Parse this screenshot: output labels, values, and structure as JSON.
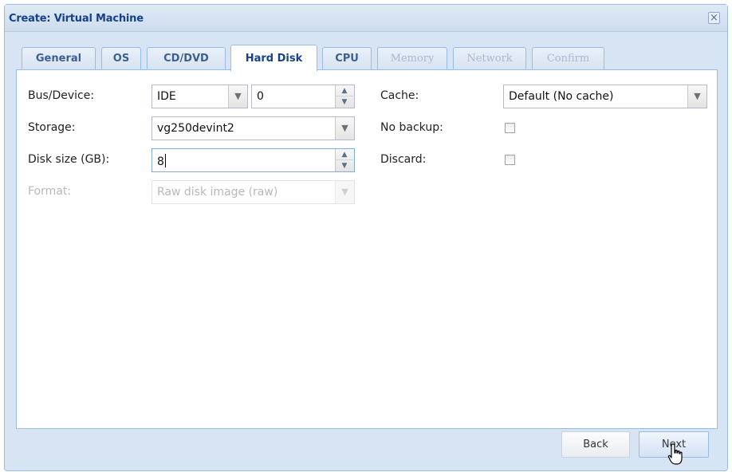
{
  "window": {
    "title": "Create: Virtual Machine",
    "close_symbol": "×"
  },
  "tabs": [
    {
      "label": "General",
      "state": "enabled"
    },
    {
      "label": "OS",
      "state": "enabled"
    },
    {
      "label": "CD/DVD",
      "state": "enabled"
    },
    {
      "label": "Hard Disk",
      "state": "active"
    },
    {
      "label": "CPU",
      "state": "enabled"
    },
    {
      "label": "Memory",
      "state": "disabled"
    },
    {
      "label": "Network",
      "state": "disabled"
    },
    {
      "label": "Confirm",
      "state": "disabled"
    }
  ],
  "form": {
    "bus_device": {
      "label": "Bus/Device:",
      "bus": "IDE",
      "device": "0"
    },
    "storage": {
      "label": "Storage:",
      "value": "vg250devint2"
    },
    "disk_size": {
      "label": "Disk size (GB):",
      "value": "8"
    },
    "format": {
      "label": "Format:",
      "value": "Raw disk image (raw)",
      "disabled": true
    },
    "cache": {
      "label": "Cache:",
      "value": "Default (No cache)"
    },
    "no_backup": {
      "label": "No backup:",
      "checked": false
    },
    "discard": {
      "label": "Discard:",
      "checked": false
    }
  },
  "footer": {
    "back_label": "Back",
    "next_label": "Next"
  },
  "icons": {
    "dropdown": "chevron-down-icon",
    "spinner": "spinner-icon",
    "cursor": "hand-pointer-icon"
  },
  "colors": {
    "title_text": "#15428b",
    "frame": "#d7e4f3",
    "border": "#99bbe8"
  }
}
